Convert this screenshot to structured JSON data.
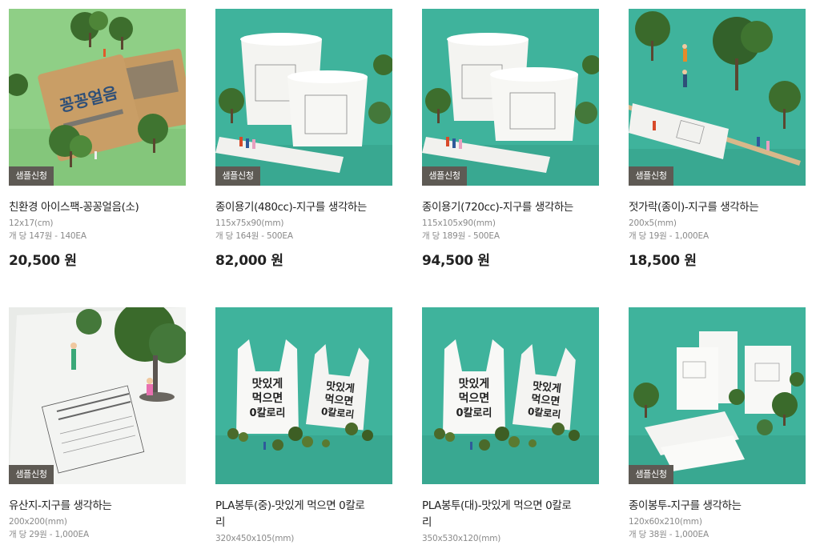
{
  "colors": {
    "green_bg": "#8fcf86",
    "mint_bg": "#3fb39c",
    "gray_bg": "#e9ebe8",
    "badge": "#5e5a54"
  },
  "products": [
    {
      "name": "친환경 아이스팩-꽁꽁얼음(소)",
      "size": "12x17(cm)",
      "unit_price": "개 당 147원 - 140EA",
      "price": "20,500 원",
      "badge": "샘플신청",
      "image": "ice-pack-photo"
    },
    {
      "name": "종이용기(480cc)-지구를 생각하는",
      "size": "115x75x90(mm)",
      "unit_price": "개 당 164원 - 500EA",
      "price": "82,000 원",
      "badge": "샘플신청",
      "image": "paper-container-photo"
    },
    {
      "name": "종이용기(720cc)-지구를 생각하는",
      "size": "115x105x90(mm)",
      "unit_price": "개 당 189원 - 500EA",
      "price": "94,500 원",
      "badge": "샘플신청",
      "image": "paper-container-photo"
    },
    {
      "name": "젓가락(종이)-지구를 생각하는",
      "size": "200x5(mm)",
      "unit_price": "개 당 19원 - 1,000EA",
      "price": "18,500 원",
      "badge": "샘플신청",
      "image": "chopsticks-photo"
    },
    {
      "name": "유산지-지구를 생각하는",
      "size": "200x200(mm)",
      "unit_price": "개 당 29원 - 1,000EA",
      "badge": "샘플신청",
      "image": "wax-paper-photo"
    },
    {
      "name_line1": "PLA봉투(중)-맛있게 먹으면 0칼로",
      "name_line2": "리",
      "size": "320x450x105(mm)",
      "image": "pla-bag-photo",
      "bag_text": [
        "맛있게",
        "먹으면",
        "0칼로리"
      ]
    },
    {
      "name_line1": "PLA봉투(대)-맛있게 먹으면 0칼로",
      "name_line2": "리",
      "size": "350x530x120(mm)",
      "image": "pla-bag-photo",
      "bag_text": [
        "맛있게",
        "먹으면",
        "0칼로리"
      ]
    },
    {
      "name": "종이봉투-지구를 생각하는",
      "size": "120x60x210(mm)",
      "unit_price": "개 당 38원 - 1,000EA",
      "badge": "샘플신청",
      "image": "paper-bag-photo"
    }
  ],
  "ice_pack_label": "꽁꽁얼음"
}
